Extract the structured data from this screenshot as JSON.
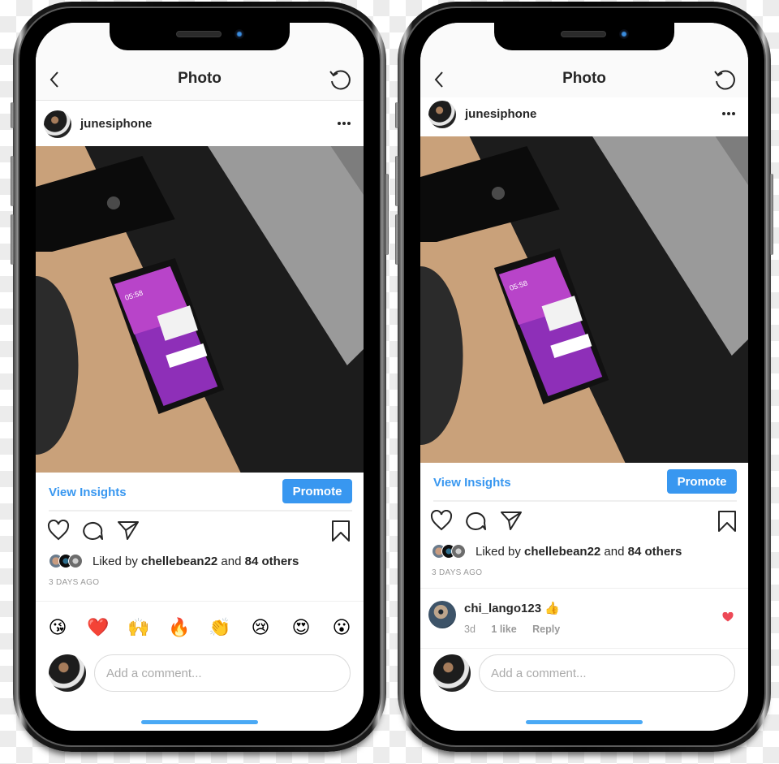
{
  "theme": {
    "accent": "#3897f0",
    "text": "#262626",
    "muted": "#999999",
    "heart_red": "#ed4956",
    "home_indicator": "#4aa9f5"
  },
  "phones": [
    {
      "nav": {
        "title": "Photo",
        "back_icon": "chevron-left-icon",
        "refresh_icon": "refresh-icon"
      },
      "post": {
        "username": "junesiphone",
        "more_icon": "more-horizontal-icon",
        "photo_alt": "iPhone with purple wallpaper on desk beside laptop and speaker",
        "photo_clock": "05:58"
      },
      "insights": {
        "view_insights": "View Insights",
        "promote": "Promote"
      },
      "actions": [
        "heart-icon",
        "comment-icon",
        "share-icon",
        "bookmark-icon"
      ],
      "likes": {
        "prefix": "Liked by ",
        "user": "chellebean22",
        "middle": " and ",
        "count": "84 others"
      },
      "timestamp": "3 DAYS AGO",
      "quick_reactions": [
        "😘",
        "❤️",
        "🙌",
        "🔥",
        "👏",
        "😢",
        "😍",
        "😮"
      ],
      "comment_input": {
        "placeholder": "Add a comment..."
      }
    },
    {
      "nav": {
        "title": "Photo",
        "back_icon": "chevron-left-icon",
        "refresh_icon": "refresh-icon"
      },
      "post": {
        "username": "junesiphone",
        "more_icon": "more-horizontal-icon",
        "photo_alt": "iPhone with purple wallpaper on desk beside laptop and speaker",
        "photo_clock": "05:58"
      },
      "insights": {
        "view_insights": "View Insights",
        "promote": "Promote"
      },
      "actions": [
        "heart-icon",
        "comment-icon",
        "share-icon",
        "bookmark-icon"
      ],
      "likes": {
        "prefix": "Liked by ",
        "user": "chellebean22",
        "middle": " and ",
        "count": "84 others"
      },
      "timestamp": "3 DAYS AGO",
      "comment": {
        "username": "chi_lango123",
        "emoji": "👍",
        "age": "3d",
        "likes": "1 like",
        "reply": "Reply",
        "liked": true
      },
      "comment_input": {
        "placeholder": "Add a comment..."
      }
    }
  ]
}
